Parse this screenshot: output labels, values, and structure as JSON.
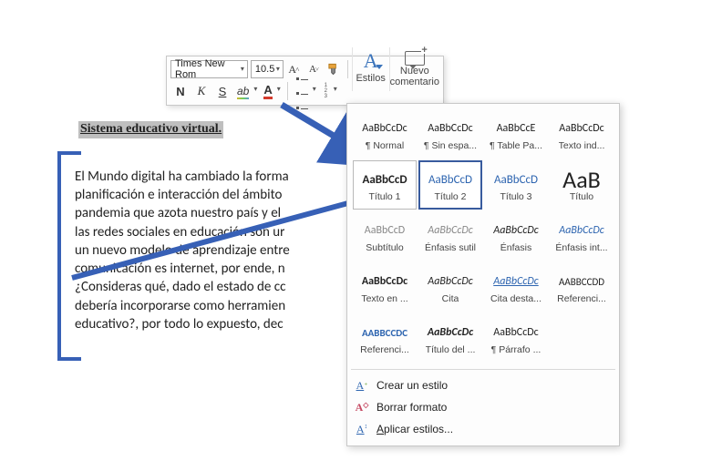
{
  "toolbar": {
    "font_name": "Times New Rom",
    "font_size": "10.5",
    "bold": "N",
    "italic": "K",
    "underline": "S",
    "styles_group": "Estilos",
    "comment_group_l1": "Nuevo",
    "comment_group_l2": "comentario"
  },
  "document": {
    "title": "Sistema educativo virtual.",
    "body_lines": [
      "El Mundo digital ha cambiado la forma",
      "planificación e interacción del ámbito",
      "pandemia que azota nuestro país y el",
      "las redes sociales en educación son ur",
      "un nuevo modelo de aprendizaje entre",
      "comunicación es internet, por ende, n",
      "¿Consideras qué, dado el estado de cc",
      "debería incorporarse como herramien",
      "educativo?, por todo lo expuesto, dec"
    ]
  },
  "styles": {
    "items": [
      {
        "sample": "AaBbCcDc",
        "label": "¶ Normal",
        "css": "font:12px Calibri;color:#222"
      },
      {
        "sample": "AaBbCcDc",
        "label": "¶ Sin espa...",
        "css": "font:12px Calibri;color:#222"
      },
      {
        "sample": "AaBbCcE",
        "label": "¶ Table Pa...",
        "css": "font:12px Calibri;color:#222"
      },
      {
        "sample": "AaBbCcDc",
        "label": "Texto ind...",
        "css": "font:12px Calibri;color:#222"
      },
      {
        "sample": "AaBbCcD",
        "label": "Título 1",
        "css": "font:700 13px Calibri;color:#222",
        "outlined": true
      },
      {
        "sample": "AaBbCcD",
        "label": "Título 2",
        "css": "font:400 13px Calibri;color:#2e65b0",
        "selected": true
      },
      {
        "sample": "AaBbCcD",
        "label": "Título 3",
        "css": "font:400 13px Calibri;color:#2e65b0"
      },
      {
        "sample": "AaB",
        "label": "Título",
        "css": "font:400 26px Calibri;color:#222"
      },
      {
        "sample": "AaBbCcD",
        "label": "Subtítulo",
        "css": "font:400 12px Calibri;color:#888"
      },
      {
        "sample": "AaBbCcDc",
        "label": "Énfasis sutil",
        "css": "font:italic 12px Calibri;color:#888"
      },
      {
        "sample": "AaBbCcDc",
        "label": "Énfasis",
        "css": "font:italic 12px Calibri;color:#222"
      },
      {
        "sample": "AaBbCcDc",
        "label": "Énfasis int...",
        "css": "font:italic 12px Calibri;color:#2e65b0"
      },
      {
        "sample": "AaBbCcDc",
        "label": "Texto en ...",
        "css": "font:700 12px Calibri;color:#222"
      },
      {
        "sample": "AaBbCcDc",
        "label": "Cita",
        "css": "font:italic 12px Calibri;color:#222"
      },
      {
        "sample": "AaBbCcDc",
        "label": "Cita desta...",
        "css": "font:italic 12px Calibri;color:#2e65b0;text-decoration:underline"
      },
      {
        "sample": "AABBCCDD",
        "label": "Referenci...",
        "css": "font:400 11px Calibri;color:#222"
      },
      {
        "sample": "AABBCCDC",
        "label": "Referenci...",
        "css": "font:700 11px Calibri;color:#2e65b0"
      },
      {
        "sample": "AaBbCcDc",
        "label": "Título del ...",
        "css": "font:italic 700 12px Calibri;color:#222"
      },
      {
        "sample": "AaBbCcDc",
        "label": "¶ Párrafo ...",
        "css": "font:400 12px Calibri;color:#222"
      }
    ],
    "footer": {
      "create": "Crear un estilo",
      "clear": "Borrar formato",
      "apply": "Aplicar estilos..."
    }
  }
}
